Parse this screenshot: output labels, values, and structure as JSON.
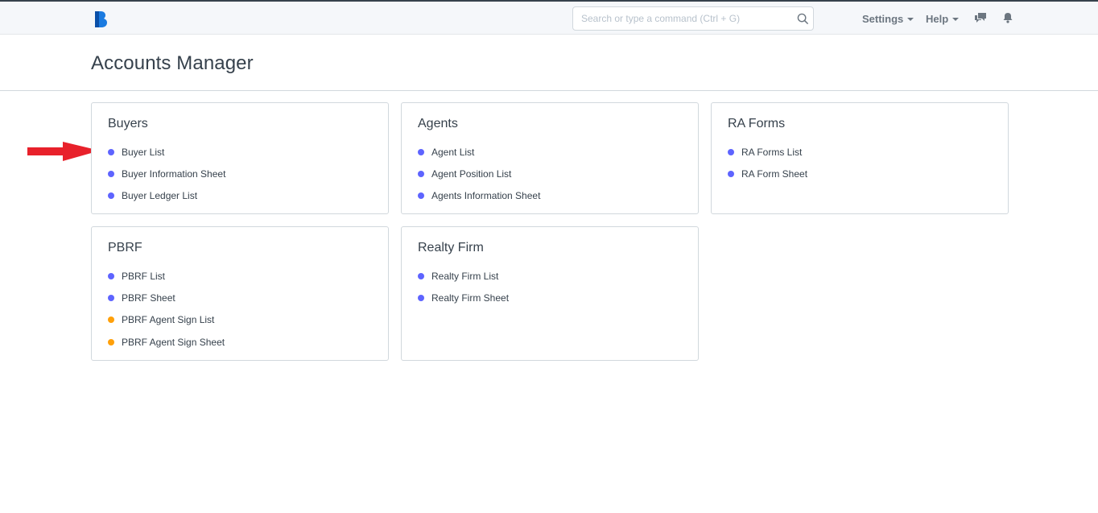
{
  "topbar": {
    "search": {
      "placeholder": "Search or type a command (Ctrl + G)",
      "value": ""
    },
    "settings_label": "Settings",
    "help_label": "Help",
    "icons": [
      "app-logo-icon",
      "search-icon",
      "chat-icon",
      "bell-icon"
    ]
  },
  "page": {
    "title": "Accounts Manager"
  },
  "colors": {
    "dot_primary": "#5e64ff",
    "dot_warning": "#ffa00a",
    "annotation_arrow": "#e8212b"
  },
  "cards": [
    {
      "title": "Buyers",
      "items": [
        {
          "label": "Buyer List",
          "status": "primary"
        },
        {
          "label": "Buyer Information Sheet",
          "status": "primary"
        },
        {
          "label": "Buyer Ledger List",
          "status": "primary"
        }
      ]
    },
    {
      "title": "Agents",
      "items": [
        {
          "label": "Agent List",
          "status": "primary"
        },
        {
          "label": "Agent Position List",
          "status": "primary"
        },
        {
          "label": "Agents Information Sheet",
          "status": "primary"
        }
      ]
    },
    {
      "title": "RA Forms",
      "items": [
        {
          "label": "RA Forms List",
          "status": "primary"
        },
        {
          "label": "RA Form Sheet",
          "status": "primary"
        }
      ]
    },
    {
      "title": "PBRF",
      "items": [
        {
          "label": "PBRF List",
          "status": "primary"
        },
        {
          "label": "PBRF Sheet",
          "status": "primary"
        },
        {
          "label": "PBRF Agent Sign List",
          "status": "warning"
        },
        {
          "label": "PBRF Agent Sign Sheet",
          "status": "warning"
        }
      ]
    },
    {
      "title": "Realty Firm",
      "items": [
        {
          "label": "Realty Firm List",
          "status": "primary"
        },
        {
          "label": "Realty Firm Sheet",
          "status": "primary"
        }
      ]
    }
  ]
}
